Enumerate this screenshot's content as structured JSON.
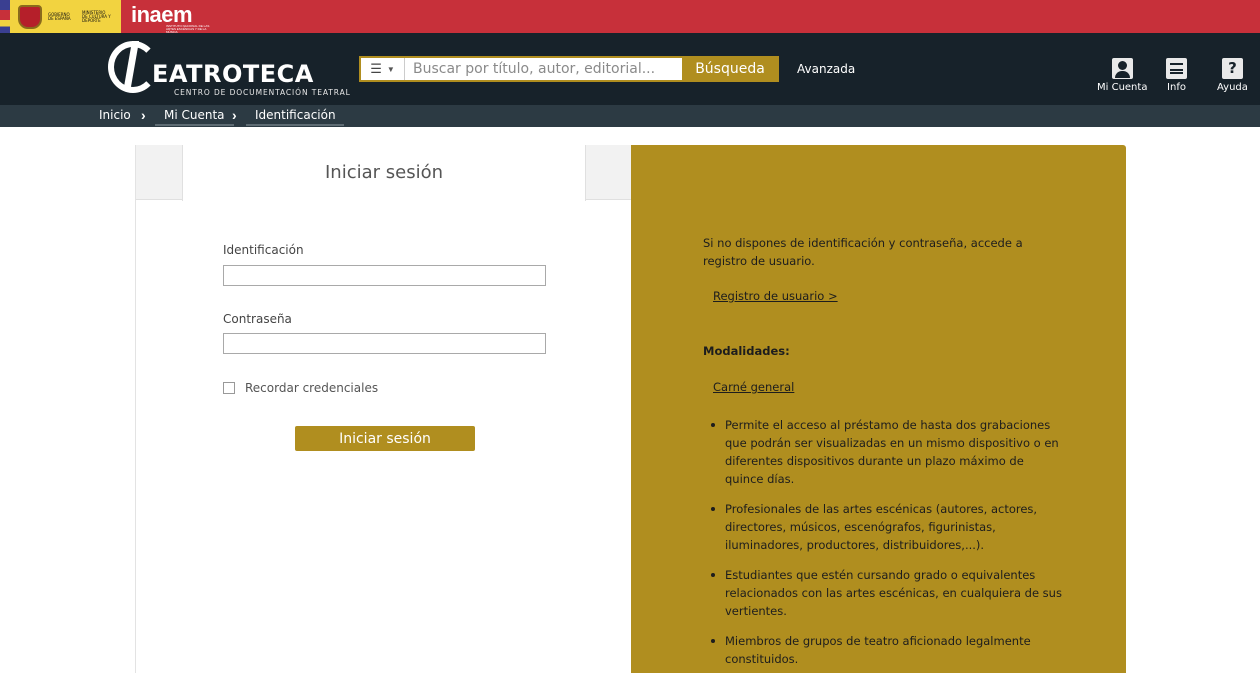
{
  "gov": {
    "ministry_left": "GOBIERNO DE ESPAÑA",
    "ministry_right": "MINISTERIO DE CULTURA Y DEPORTE",
    "inaem": "inaem",
    "inaem_sub": "INSTITUTO NACIONAL DE LAS ARTES ESCÉNICAS Y DE LA MÚSICA"
  },
  "header": {
    "logo_title": "EATROTECA",
    "logo_subtitle": "CENTRO DE DOCUMENTACIÓN TEATRAL",
    "search_placeholder": "Buscar por título, autor, editorial...",
    "search_button": "Búsqueda",
    "advanced_link": "Avanzada",
    "icons": [
      {
        "label": "Mi Cuenta",
        "icon": "user-icon"
      },
      {
        "label": "Info",
        "icon": "menu-icon"
      },
      {
        "label": "Ayuda",
        "icon": "help-icon",
        "glyph": "?"
      }
    ]
  },
  "breadcrumb": [
    "Inicio",
    "Mi Cuenta",
    "Identificación"
  ],
  "login": {
    "tab_title": "Iniciar sesión",
    "id_label": "Identificación",
    "password_label": "Contraseña",
    "remember_label": "Recordar credenciales",
    "submit_label": "Iniciar sesión"
  },
  "info": {
    "intro": "Si no dispones de identificación y contraseña, accede a registro de usuario.",
    "register_link": "Registro de usuario >",
    "modalities_heading": "Modalidades:",
    "general_card_link": "Carné general",
    "items": [
      "Permite el acceso al préstamo de hasta dos grabaciones que podrán ser visualizadas en un mismo dispositivo o en diferentes dispositivos durante un plazo máximo de quince días.",
      "Profesionales de las artes escénicas (autores, actores, directores, músicos, escenógrafos, figurinistas, iluminadores, productores, distribuidores,...).",
      "Estudiantes que estén cursando grado o equivalentes relacionados con las artes escénicas, en cualquiera de sus vertientes.",
      "Miembros de grupos de teatro aficionado legalmente constituidos."
    ]
  },
  "colors": {
    "gov_red": "#c7303a",
    "header_dark": "#17222a",
    "breadcrumb_bg": "#2c3a43",
    "accent_gold": "#b08e1f"
  }
}
